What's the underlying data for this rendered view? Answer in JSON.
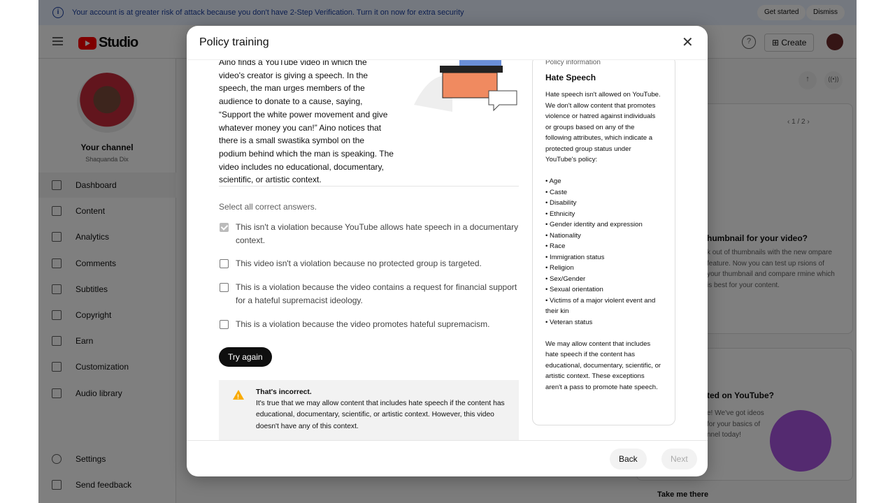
{
  "banner": {
    "message": "Your account is at greater risk of attack because you don't have 2-Step Verification. Turn it on now for extra security",
    "get_started": "Get started",
    "dismiss": "Dismiss"
  },
  "header": {
    "logo": "Studio",
    "create": "Create"
  },
  "sidebar": {
    "channel_label": "Your channel",
    "channel_name": "Shaquanda Dix",
    "items": [
      {
        "label": "Dashboard",
        "icon": "dashboard-icon"
      },
      {
        "label": "Content",
        "icon": "content-icon"
      },
      {
        "label": "Analytics",
        "icon": "analytics-icon"
      },
      {
        "label": "Comments",
        "icon": "comments-icon"
      },
      {
        "label": "Subtitles",
        "icon": "subtitles-icon"
      },
      {
        "label": "Copyright",
        "icon": "copyright-icon"
      },
      {
        "label": "Earn",
        "icon": "earn-icon"
      },
      {
        "label": "Customization",
        "icon": "customization-icon"
      },
      {
        "label": "Audio library",
        "icon": "audio-library-icon"
      }
    ],
    "settings": "Settings",
    "feedback": "Send feedback"
  },
  "background": {
    "pager": "1 / 2",
    "card1_title": "humbnail for your video?",
    "card1_text": "k out of thumbnails with the new ompare feature. Now you can test up rsions of your thumbnail and compare rmine which is best for your content.",
    "card2_title": "ted on YouTube?",
    "card2_text": "e! We've got ideos for your basics of nnel today!",
    "take_me_there": "Take me there"
  },
  "modal": {
    "title": "Policy training",
    "scenario": "Aino finds a YouTube video in which the video's creator is giving a speech. In the speech, the man urges members of the audience to donate to a cause, saying, “Support the white power movement and give whatever money you can!” Aino notices that there is a small swastika symbol on the podium behind which the man is speaking. The video includes no educational, documentary, scientific, or artistic context.",
    "prompt": "Select all correct answers.",
    "options": [
      {
        "text": "This isn't a violation because YouTube allows hate speech in a documentary context.",
        "checked": true
      },
      {
        "text": "This video isn't a violation because no protected group is targeted.",
        "checked": false
      },
      {
        "text": "This is a violation because the video contains a request for financial support for a hateful supremacist ideology.",
        "checked": false
      },
      {
        "text": "This is a violation because the video promotes hateful supremacism.",
        "checked": false
      }
    ],
    "try_again": "Try again",
    "feedback": {
      "title": "That's incorrect.",
      "text": "It's true that we may allow content that includes hate speech if the content has educational, documentary, scientific, or artistic context. However, this video doesn't have any of this context."
    },
    "policy": {
      "header": "Policy information",
      "title": "Hate Speech",
      "intro": "Hate speech isn't allowed on YouTube. We don't allow content that promotes violence or hatred against individuals or groups based on any of the following attributes, which indicate a protected group status under YouTube's policy:",
      "attributes": [
        "• Age",
        "• Caste",
        "• Disability",
        "• Ethnicity",
        "• Gender identity and expression",
        "• Nationality",
        "• Race",
        "• Immigration status",
        "• Religion",
        "• Sex/Gender",
        "• Sexual orientation",
        "• Victims of a major violent event and their kin",
        "• Veteran status"
      ],
      "outro": "We may allow content that includes hate speech if the content has educational, documentary, scientific, or artistic context. These exceptions aren't a pass to promote hate speech."
    },
    "back": "Back",
    "next": "Next"
  }
}
